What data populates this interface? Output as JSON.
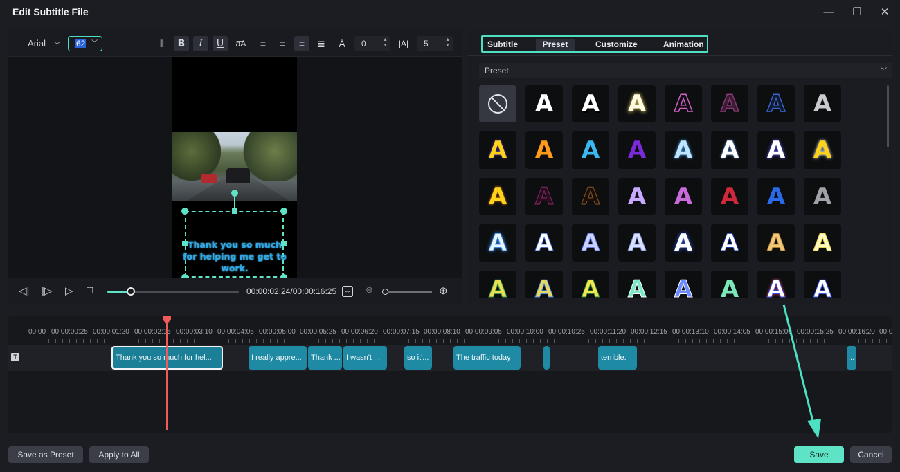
{
  "window": {
    "title": "Edit Subtitle File",
    "minimize_icon": "minimize-icon",
    "maximize_icon": "restore-icon",
    "close_icon": "close-icon"
  },
  "toolbar": {
    "font": "Arial",
    "font_size": "62",
    "letter_spacing": "0",
    "line_spacing": "5"
  },
  "preview": {
    "subtitle_text": "Thank you so much for helping me get to work."
  },
  "player": {
    "timecode": "00:00:02:24/00:00:16:25",
    "progress": 0.18
  },
  "tabs": [
    {
      "label": "Subtitle"
    },
    {
      "label": "Preset"
    },
    {
      "label": "Customize"
    },
    {
      "label": "Animation"
    }
  ],
  "active_tab": "Preset",
  "preset_dropdown": {
    "label": "Preset"
  },
  "timeline": {
    "ruler_labels": [
      "00:00",
      "00:00:00:25",
      "00:00:01:20",
      "00:00:02:15",
      "00:00:03:10",
      "00:00:04:05",
      "00:00:05:00",
      "00:00:05:25",
      "00:00:06:20",
      "00:00:07:15",
      "00:00:08:10",
      "00:00:09:05",
      "00:00:10:00",
      "00:00:10:25",
      "00:00:11:20",
      "00:00:12:15",
      "00:00:13:10",
      "00:00:14:05",
      "00:00:15:00",
      "00:00:15:25",
      "00:00:16:20",
      "00:0"
    ],
    "clips": [
      {
        "label": "Thank you so much for hel...",
        "selected": true
      },
      {
        "label": "I really appre..."
      },
      {
        "label": "Thank ..."
      },
      {
        "label": "I wasn't ..."
      },
      {
        "label": "so it'..."
      },
      {
        "label": "The traffic today"
      },
      {
        "label": ""
      },
      {
        "label": "terrible."
      },
      {
        "label": "..."
      }
    ]
  },
  "footer": {
    "save_preset": "Save as Preset",
    "apply_all": "Apply to All",
    "save": "Save",
    "cancel": "Cancel"
  },
  "colors": {
    "accent": "#5fe3c6",
    "clip": "#1f8aa4",
    "playhead": "#f05a5a"
  }
}
